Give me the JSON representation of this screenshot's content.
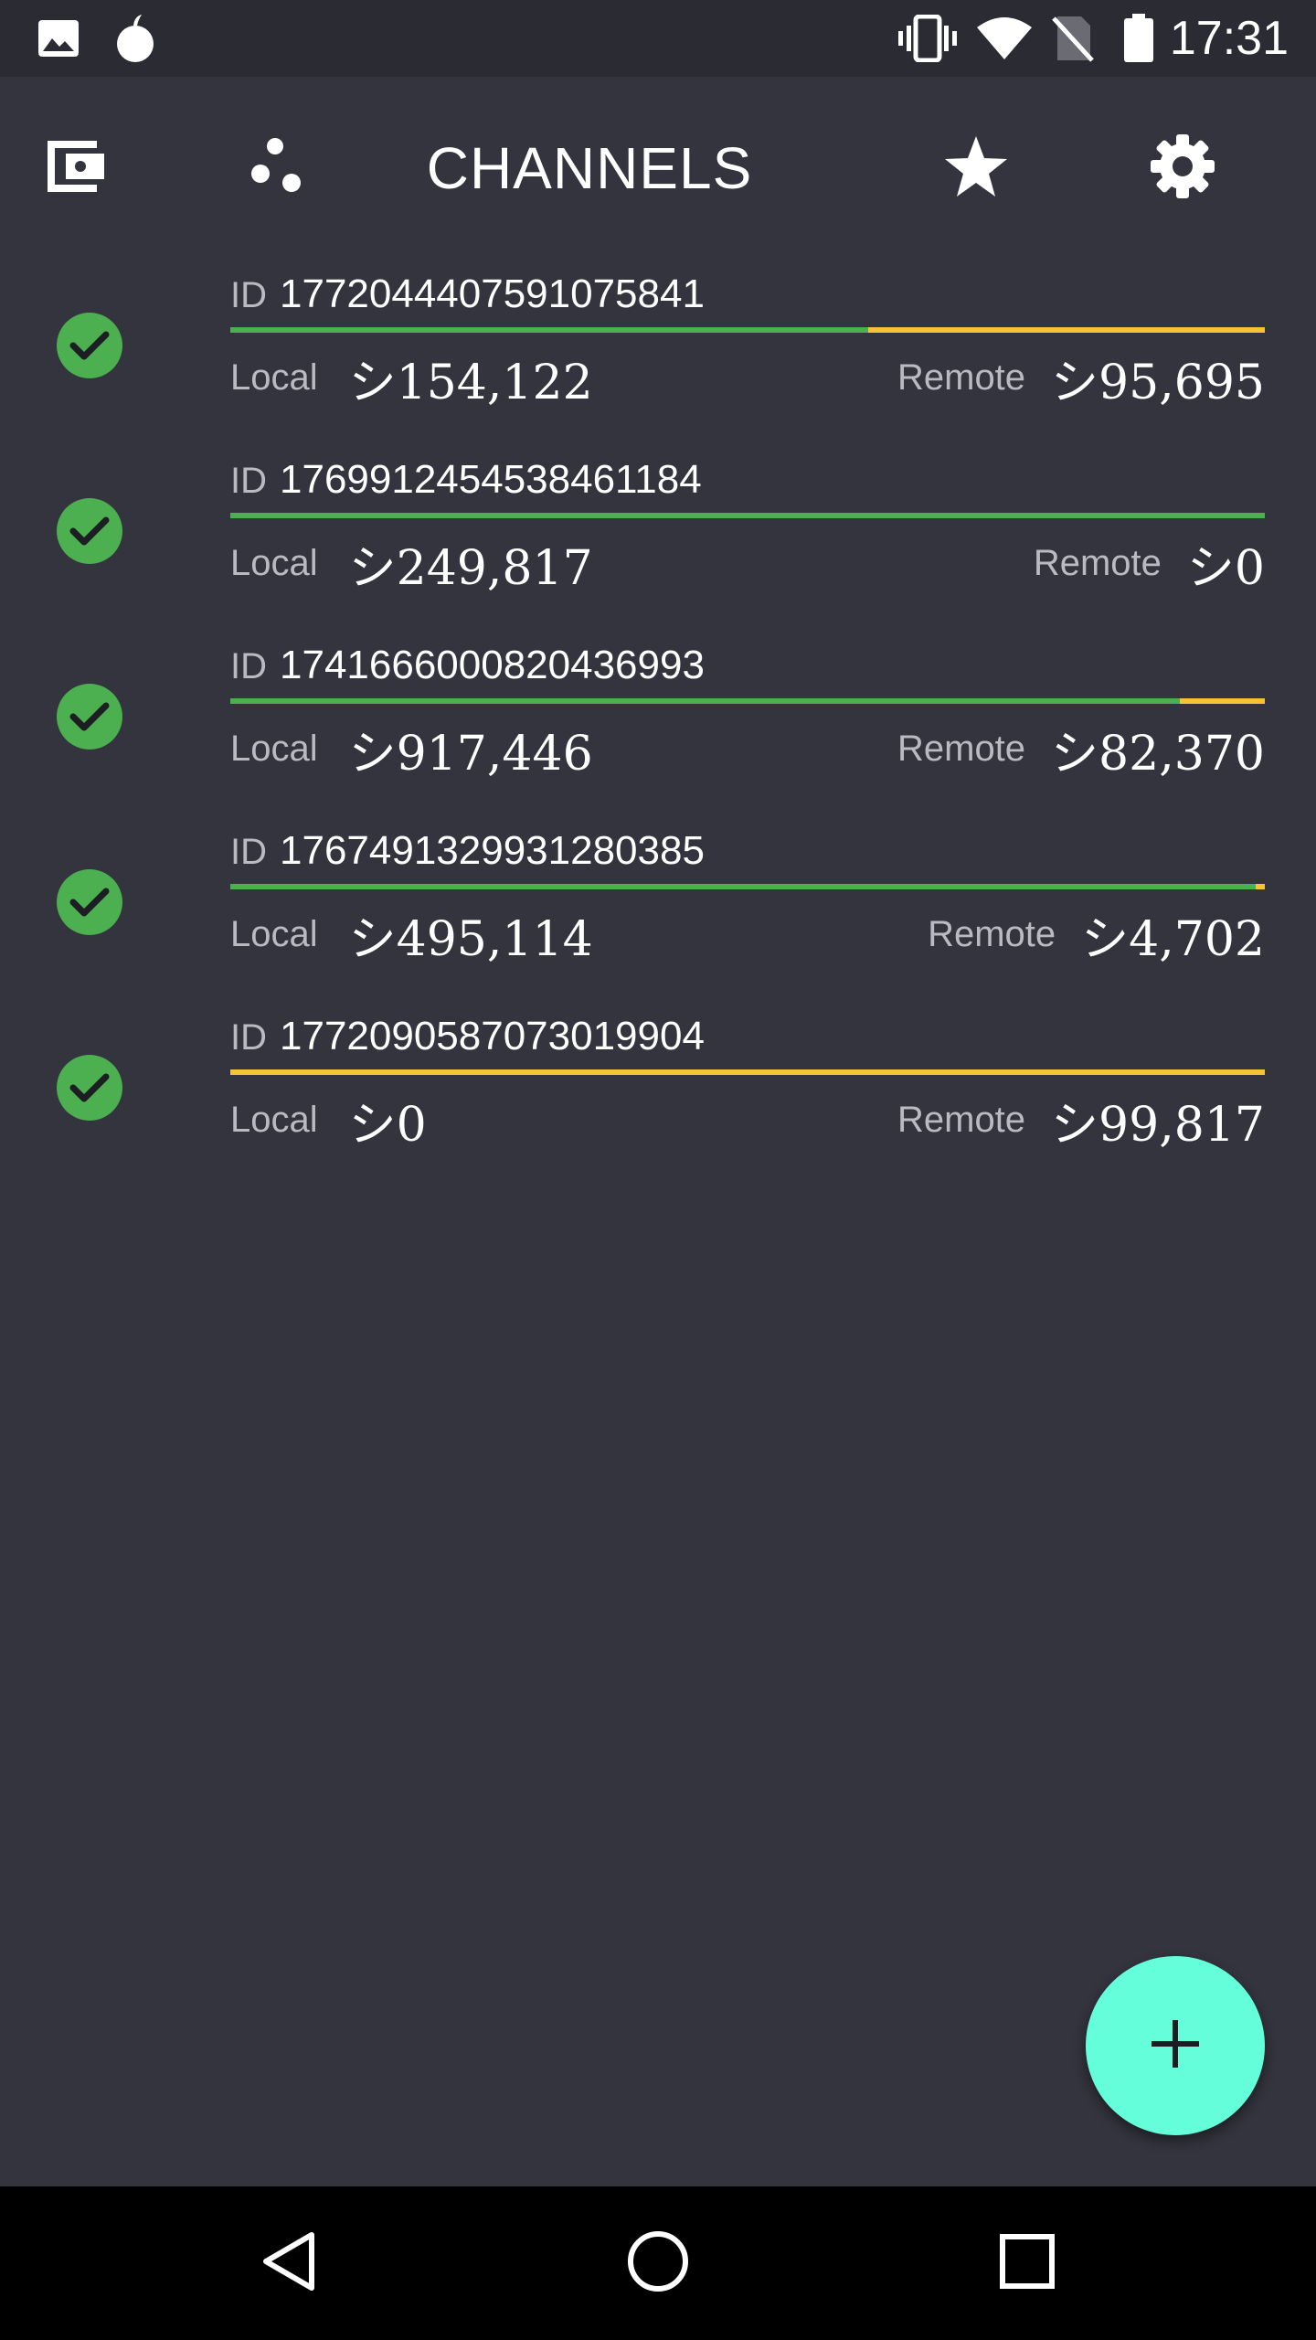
{
  "status_bar": {
    "time": "17:31",
    "left_icons": [
      "image-icon",
      "notification-app-icon"
    ],
    "right_icons": [
      "vibrate-icon",
      "wifi-icon",
      "no-sim-icon",
      "battery-icon"
    ]
  },
  "app_bar": {
    "title": "CHANNELS",
    "buttons": [
      "wallet-icon",
      "peers-icon",
      "star-icon",
      "settings-icon"
    ]
  },
  "colors": {
    "background": "#33343e",
    "status_bar": "#2a2b33",
    "local_balance": "#4caf50",
    "remote_balance": "#f7c235",
    "status_ok": "#4caf50",
    "fab": "#64ffda",
    "nav_bar": "#000000"
  },
  "channels": [
    {
      "status": "check-icon",
      "id_label": "ID",
      "id": "1772044407591075841",
      "local_label": "Local",
      "local_amount": "シ154,122",
      "remote_label": "Remote",
      "remote_amount": "シ95,695",
      "local_fraction": 0.617
    },
    {
      "status": "check-icon",
      "id_label": "ID",
      "id": "1769912454538461184",
      "local_label": "Local",
      "local_amount": "シ249,817",
      "remote_label": "Remote",
      "remote_amount": "シ0",
      "local_fraction": 1.0
    },
    {
      "status": "check-icon",
      "id_label": "ID",
      "id": "1741666000820436993",
      "local_label": "Local",
      "local_amount": "シ917,446",
      "remote_label": "Remote",
      "remote_amount": "シ82,370",
      "local_fraction": 0.918
    },
    {
      "status": "check-icon",
      "id_label": "ID",
      "id": "1767491329931280385",
      "local_label": "Local",
      "local_amount": "シ495,114",
      "remote_label": "Remote",
      "remote_amount": "シ4,702",
      "local_fraction": 0.991
    },
    {
      "status": "check-icon",
      "id_label": "ID",
      "id": "1772090587073019904",
      "local_label": "Local",
      "local_amount": "シ0",
      "remote_label": "Remote",
      "remote_amount": "シ99,817",
      "local_fraction": 0.0
    }
  ],
  "fab": {
    "icon": "plus-icon"
  },
  "nav_bar": {
    "buttons": [
      "back-icon",
      "home-icon",
      "recents-icon"
    ]
  }
}
